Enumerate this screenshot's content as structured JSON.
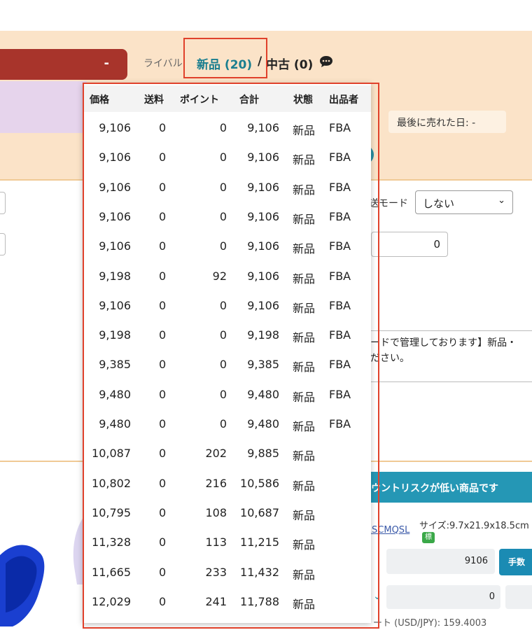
{
  "header": {
    "tab_dash": "-",
    "rival_label": "ライバル",
    "rival_new": "新品 (20)",
    "rival_sep": "/",
    "rival_used": "中古 (0)",
    "speech_icon": "speech-bubble-icon",
    "last_sold": "最後に売れた日: -",
    "colors": {
      "header_bg": "#fbe3c8",
      "red_tab": "#a8342b",
      "accent_teal": "#1a7e8f",
      "highlight": "#e0412b"
    }
  },
  "form": {
    "mode_label": "送モード",
    "mode_value": "しない",
    "qty_value": "0",
    "notes_line1": "ードで管理しております】新品・",
    "notes_line2": "ださい。"
  },
  "lower": {
    "banner": "ウントリスクが低い商品です",
    "asin_link": "RSCMQSL",
    "size_label": "サイズ:",
    "size_value": "9.7x21.9x18.5cm",
    "std_badge": "標",
    "price_value": "9106",
    "fee_button": "手数",
    "zero_value": "0",
    "rate_text": "ート (USD/JPY): 159.4003"
  },
  "rival_table": {
    "headers": [
      "価格",
      "送料",
      "ポイント",
      "合計",
      "状態",
      "出品者"
    ],
    "rows": [
      [
        "9,106",
        "0",
        "0",
        "9,106",
        "新品",
        "FBA"
      ],
      [
        "9,106",
        "0",
        "0",
        "9,106",
        "新品",
        "FBA"
      ],
      [
        "9,106",
        "0",
        "0",
        "9,106",
        "新品",
        "FBA"
      ],
      [
        "9,106",
        "0",
        "0",
        "9,106",
        "新品",
        "FBA"
      ],
      [
        "9,106",
        "0",
        "0",
        "9,106",
        "新品",
        "FBA"
      ],
      [
        "9,198",
        "0",
        "92",
        "9,106",
        "新品",
        "FBA"
      ],
      [
        "9,106",
        "0",
        "0",
        "9,106",
        "新品",
        "FBA"
      ],
      [
        "9,198",
        "0",
        "0",
        "9,198",
        "新品",
        "FBA"
      ],
      [
        "9,385",
        "0",
        "0",
        "9,385",
        "新品",
        "FBA"
      ],
      [
        "9,480",
        "0",
        "0",
        "9,480",
        "新品",
        "FBA"
      ],
      [
        "9,480",
        "0",
        "0",
        "9,480",
        "新品",
        "FBA"
      ],
      [
        "10,087",
        "0",
        "202",
        "9,885",
        "新品",
        ""
      ],
      [
        "10,802",
        "0",
        "216",
        "10,586",
        "新品",
        ""
      ],
      [
        "10,795",
        "0",
        "108",
        "10,687",
        "新品",
        ""
      ],
      [
        "11,328",
        "0",
        "113",
        "11,215",
        "新品",
        ""
      ],
      [
        "11,665",
        "0",
        "233",
        "11,432",
        "新品",
        ""
      ],
      [
        "12,029",
        "0",
        "241",
        "11,788",
        "新品",
        ""
      ]
    ]
  }
}
